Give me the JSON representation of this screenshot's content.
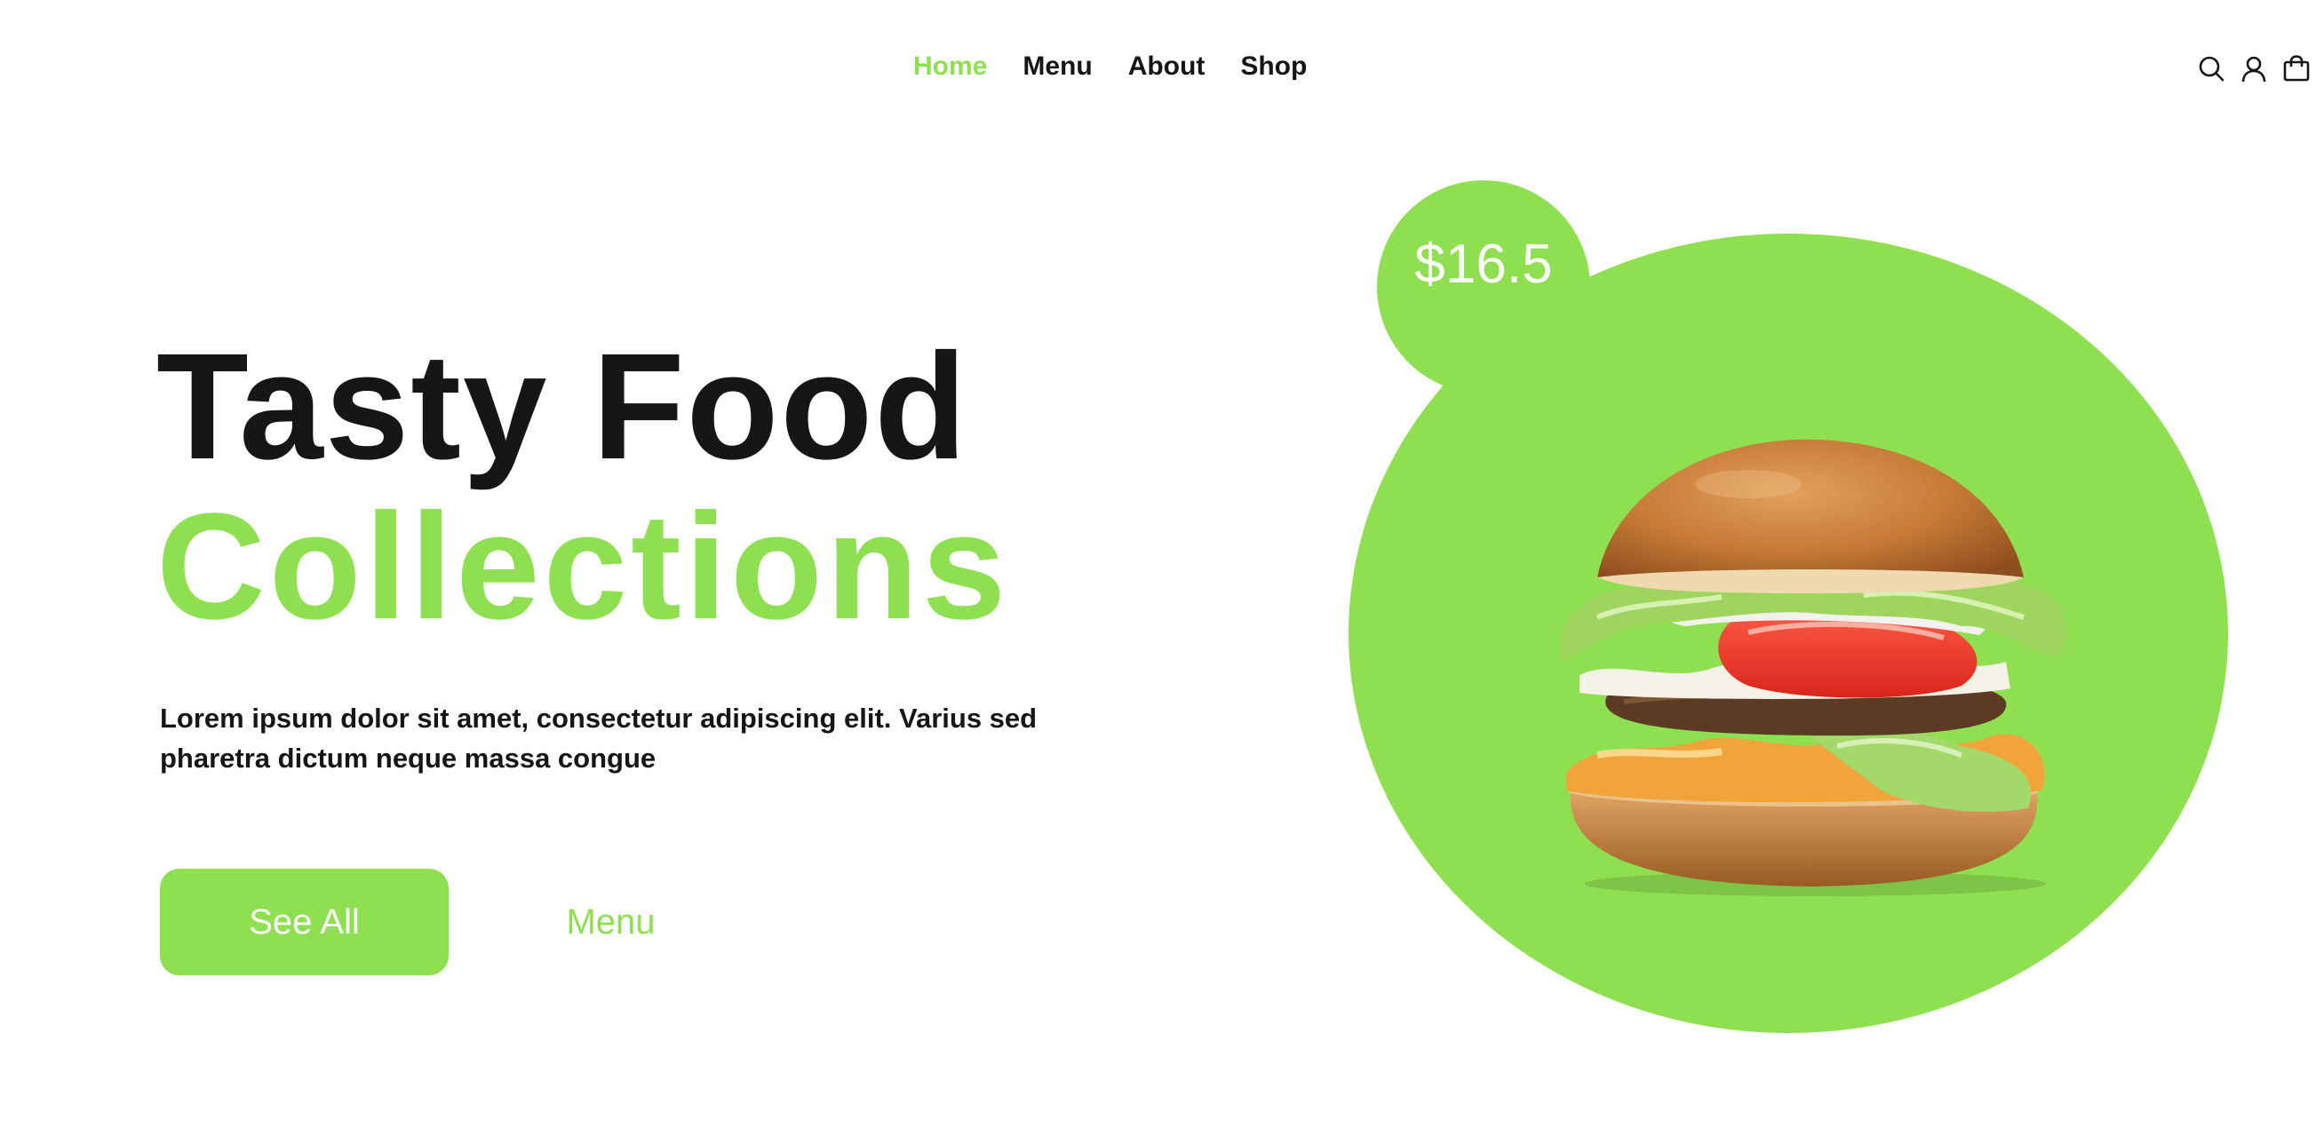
{
  "nav": {
    "items": [
      {
        "label": "Home",
        "active": true
      },
      {
        "label": "Menu",
        "active": false
      },
      {
        "label": "About",
        "active": false
      },
      {
        "label": "Shop",
        "active": false
      }
    ],
    "icons": [
      "search-icon",
      "user-icon",
      "shopping-bag-icon"
    ]
  },
  "hero": {
    "title_line1": "Tasty Food",
    "title_line2": "Collections",
    "description": "Lorem ipsum dolor sit amet, consectetur adipiscing elit. Varius sed pharetra dictum neque massa congue",
    "primary_button": "See All",
    "secondary_button": "Menu"
  },
  "product": {
    "price": "$16.5",
    "image": "burger"
  },
  "colors": {
    "accent": "#8fe051",
    "text": "#161616",
    "background": "#ffffff"
  }
}
